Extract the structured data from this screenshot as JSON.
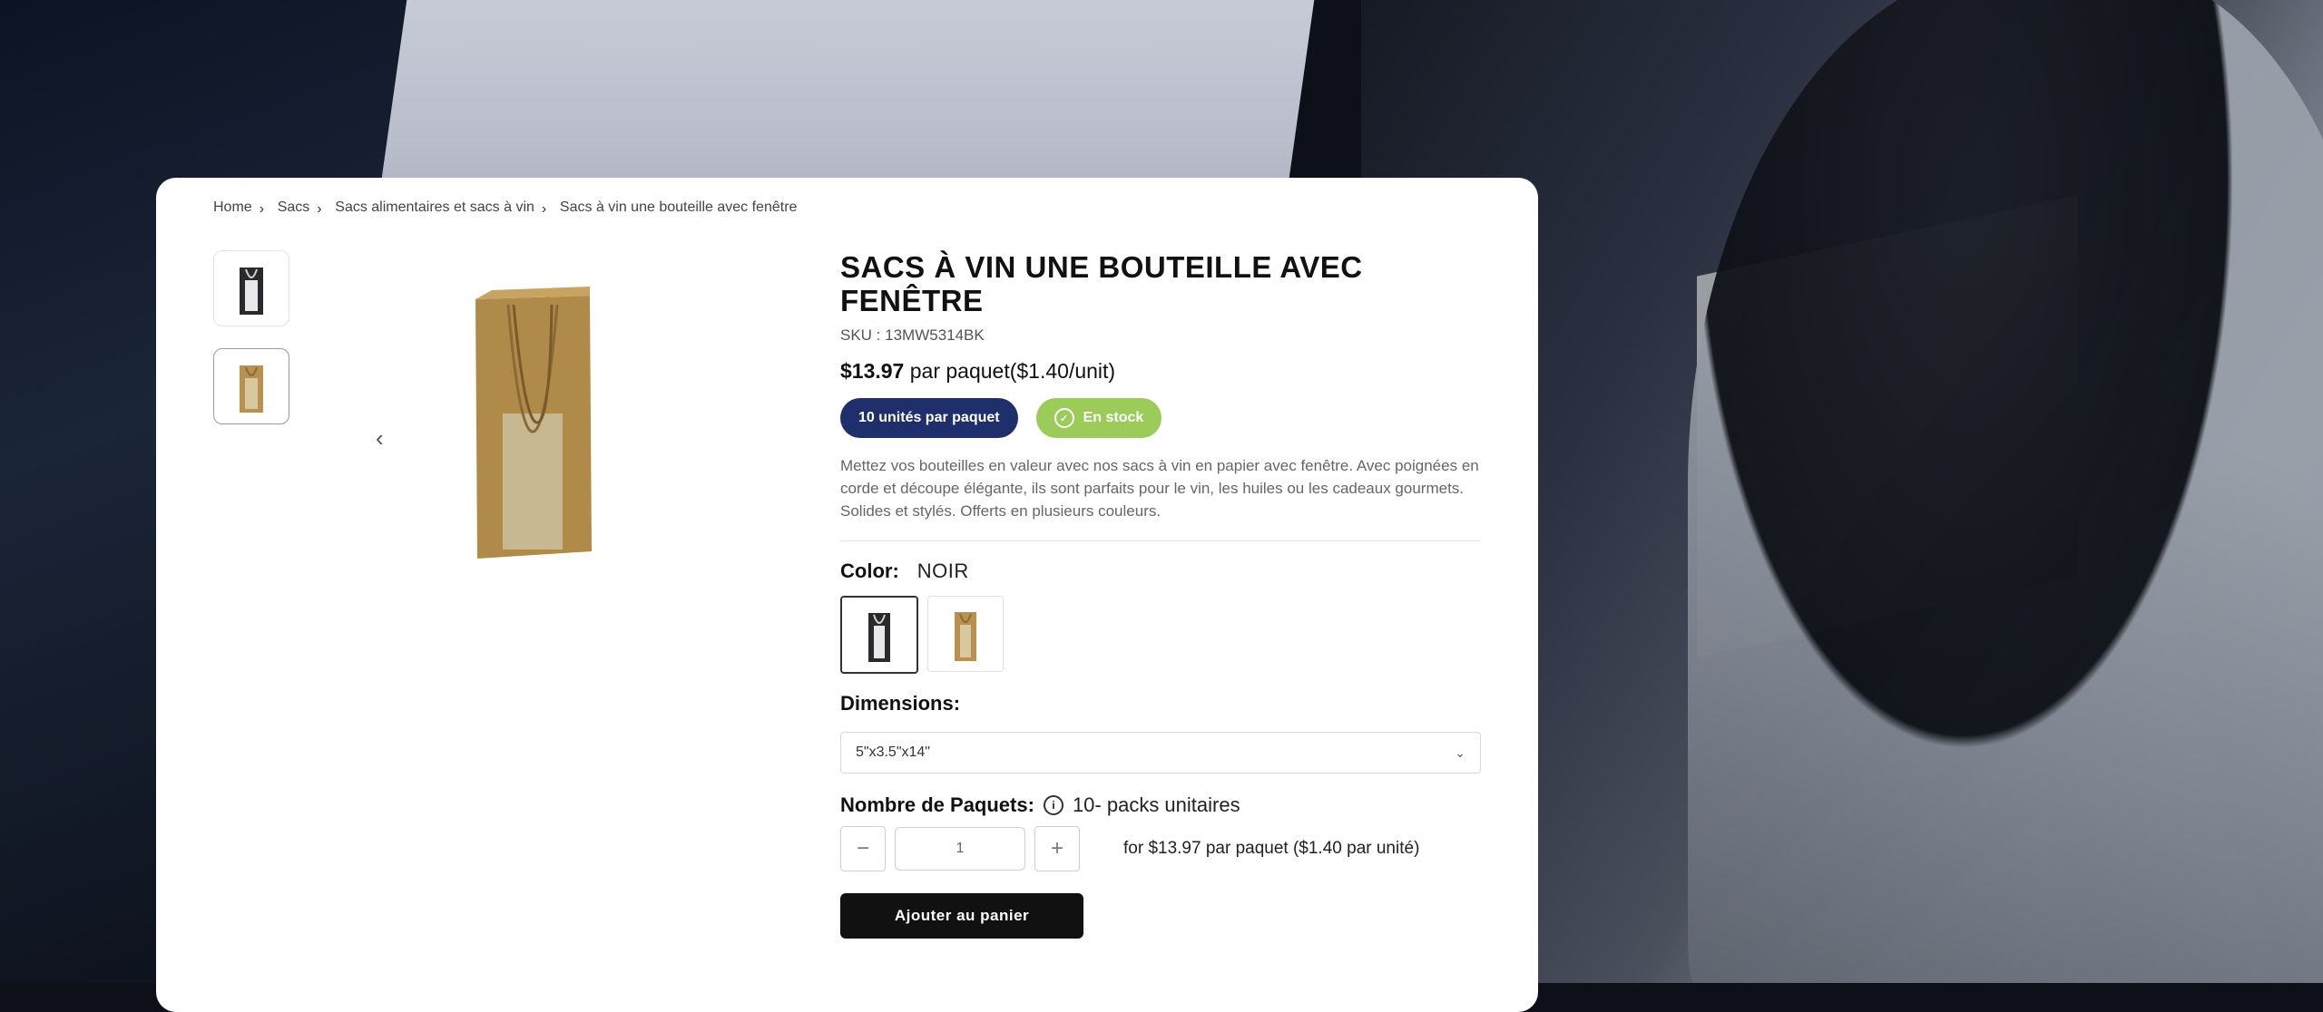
{
  "breadcrumb": [
    "Home",
    "Sacs",
    "Sacs alimentaires et sacs à vin",
    "Sacs à vin une bouteille avec fenêtre"
  ],
  "product": {
    "title": "SACS À VIN UNE BOUTEILLE AVEC FENÊTRE",
    "sku": "SKU : 13MW5314BK",
    "price": "$13.97",
    "price_suffix": "par paquet($1.40/unit)",
    "badge_units": "10 unités par paquet",
    "badge_stock": "En stock",
    "description": "Mettez vos bouteilles en valeur avec nos sacs à vin en papier avec fenêtre. Avec poignées en corde et découpe élégante, ils sont parfaits pour le vin, les huiles ou les cadeaux gourmets. Solides et stylés. Offerts en plusieurs couleurs."
  },
  "color": {
    "label": "Color:",
    "value": "NOIR"
  },
  "dimensions": {
    "label": "Dimensions:",
    "selected": "5\"x3.5\"x14\""
  },
  "quantity": {
    "label": "Nombre de Paquets:",
    "packs_info": "10- packs unitaires",
    "value": "1",
    "minus": "−",
    "plus": "+",
    "per_pack_text": "for $13.97 par paquet ($1.40 par unité)"
  },
  "cart": {
    "button": "Ajouter au panier"
  },
  "icons": {
    "breadcrumb_sep": "chevron-right-icon",
    "prev": "chevron-left-icon",
    "stock": "check-circle-icon",
    "info": "info-icon",
    "select": "chevron-down-icon"
  },
  "colors": {
    "navy": "#1f2f6b",
    "green": "#9bcc5a",
    "black_button": "#111111"
  }
}
